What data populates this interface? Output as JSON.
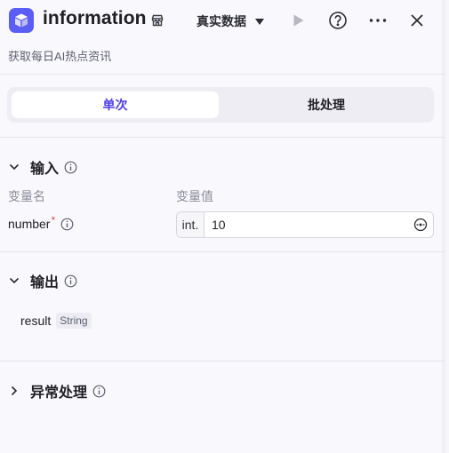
{
  "header": {
    "title": "information",
    "data_mode": "真实数据",
    "description": "获取每日AI热点资讯"
  },
  "tabs": [
    "单次",
    "批处理"
  ],
  "input_section": {
    "title": "输入",
    "col_name_label": "变量名",
    "col_value_label": "变量值",
    "variable_name": "number",
    "required_mark": "*",
    "type_prefix": "int.",
    "value": "10"
  },
  "output_section": {
    "title": "输出",
    "field_name": "result",
    "field_type": "String"
  },
  "exception_section": {
    "title": "异常处理"
  },
  "colors": {
    "accent": "#4e40e5",
    "icon_bg": "#5b5ef5",
    "required": "#e5484d"
  }
}
